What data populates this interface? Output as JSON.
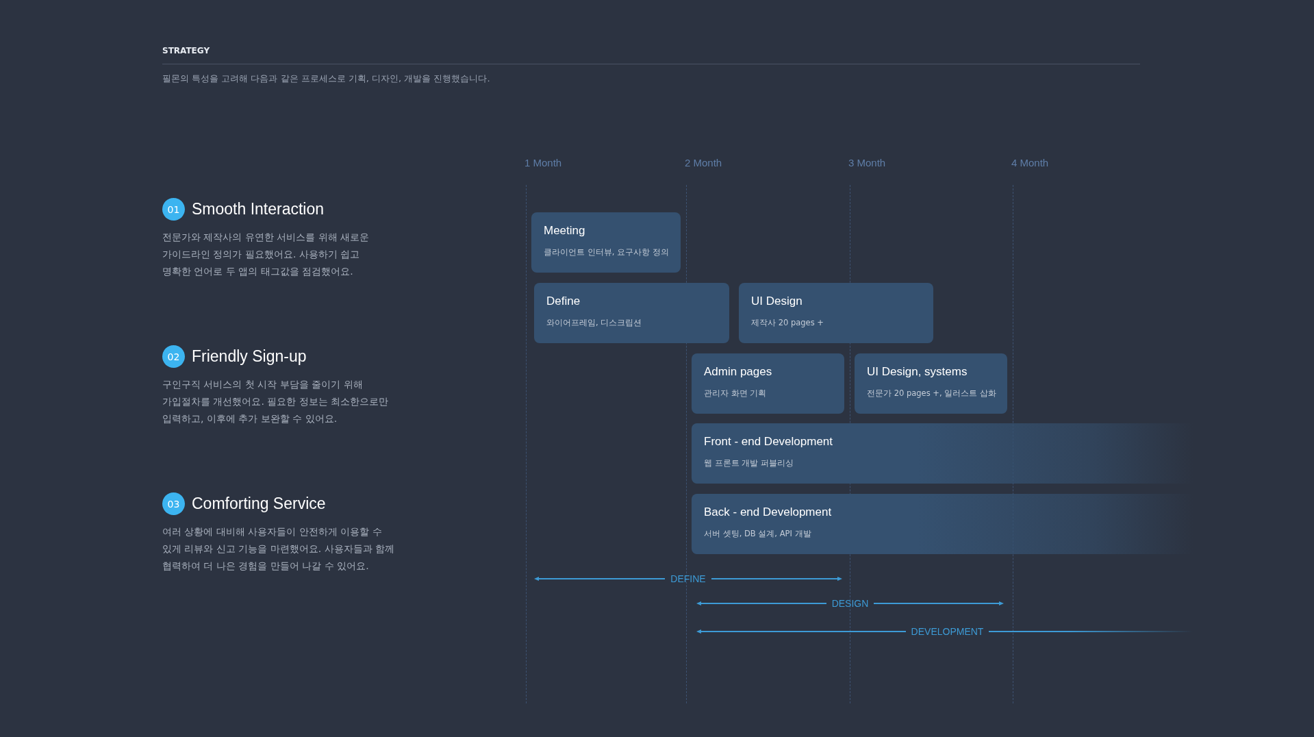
{
  "header": {
    "title": "STRATEGY",
    "subtitle": "필몬의 특성을 고려해 다음과 같은 프로세스로 기획, 디자인, 개발을 진행했습니다."
  },
  "sections": [
    {
      "number": "01",
      "title": "Smooth Interaction",
      "lines": [
        "전문가와 제작사의 유연한 서비스를 위해 새로운",
        "가이드라인 정의가 필요했어요. 사용하기 쉽고",
        "명확한 언어로 두 앱의 태그값을 점검했어요."
      ]
    },
    {
      "number": "02",
      "title": "Friendly Sign-up",
      "lines": [
        "구인구직 서비스의 첫 시작 부담을 줄이기 위해",
        "가입절차를 개선했어요. 필요한 정보는 최소한으로만",
        "입력하고, 이후에 추가 보완할 수 있어요."
      ]
    },
    {
      "number": "03",
      "title": "Comforting Service",
      "lines": [
        "여러 상황에 대비해 사용자들이 안전하게 이용할 수",
        "있게 리뷰와 신고 기능을 마련했어요. 사용자들과 함께",
        "협력하여 더 나은 경험을 만들어 나갈 수 있어요."
      ]
    }
  ],
  "timeline": {
    "months": [
      "1 Month",
      "2 Month",
      "3 Month",
      "4 Month"
    ],
    "tasks": [
      {
        "kind": "block",
        "title": "Meeting",
        "detail": "클라이언트 인터뷰, 요구사항 정의"
      },
      {
        "kind": "block",
        "title": "Define",
        "detail": "와이어프레임, 디스크립션"
      },
      {
        "kind": "block",
        "title": "UI Design",
        "detail": "제작사 20 pages +"
      },
      {
        "kind": "block",
        "title": "Admin pages",
        "detail": "관리자 화면 기획"
      },
      {
        "kind": "block",
        "title": "UI Design, systems",
        "detail": "전문가 20 pages +, 일러스트 삽화"
      },
      {
        "kind": "ongoing",
        "title": "Front - end Development",
        "detail": "웹 프론트 개발 퍼블리싱"
      },
      {
        "kind": "ongoing",
        "title": "Back - end Development",
        "detail": "서버 셋팅, DB 설계, API 개발"
      }
    ],
    "phases": [
      {
        "kind": "bounded",
        "label": "DEFINE"
      },
      {
        "kind": "bounded",
        "label": "DESIGN"
      },
      {
        "kind": "open",
        "label": "DEVELOPMENT"
      }
    ]
  }
}
